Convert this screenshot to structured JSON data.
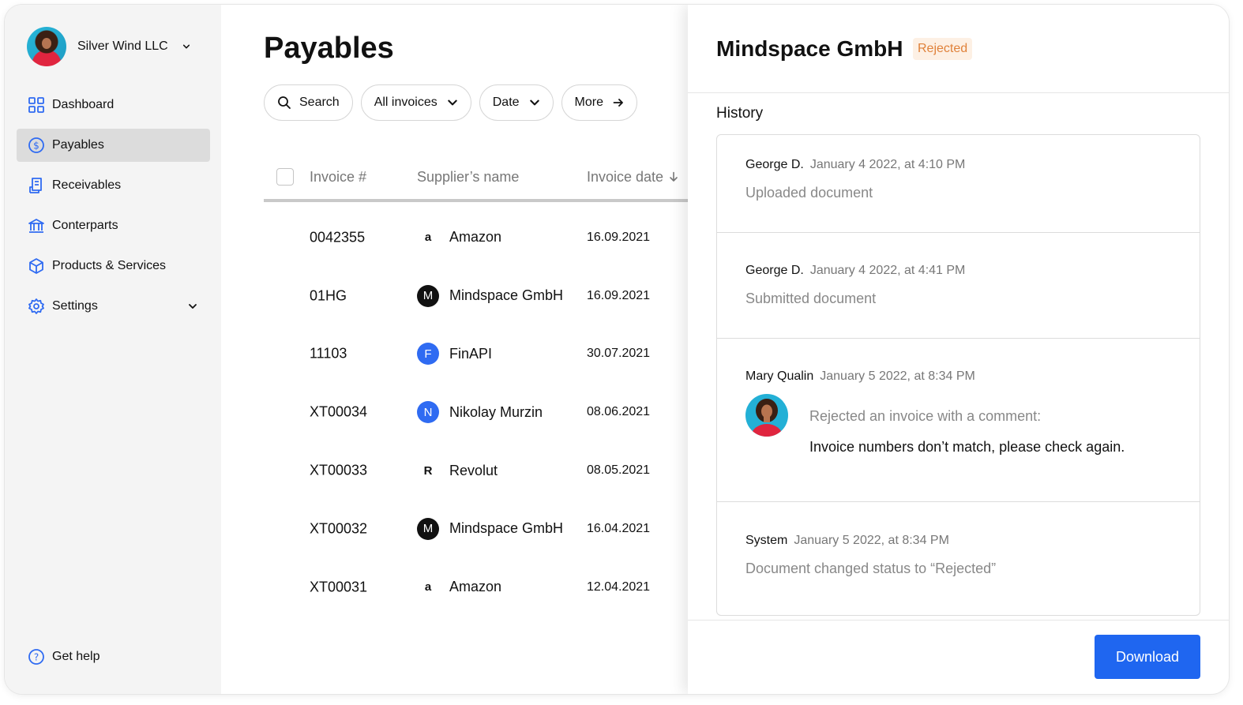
{
  "sidebar": {
    "org_name": "Silver Wind LLC",
    "items": [
      {
        "label": "Dashboard",
        "icon": "grid-icon"
      },
      {
        "label": "Payables",
        "icon": "dollar-circle-icon"
      },
      {
        "label": "Receivables",
        "icon": "receipt-icon"
      },
      {
        "label": "Conterparts",
        "icon": "bank-icon"
      },
      {
        "label": "Products & Services",
        "icon": "box-icon"
      },
      {
        "label": "Settings",
        "icon": "gear-icon"
      }
    ],
    "help_label": "Get help"
  },
  "main": {
    "title": "Payables",
    "filters": {
      "search": "Search",
      "all_invoices": "All invoices",
      "date": "Date",
      "more": "More"
    },
    "columns": {
      "invoice": "Invoice #",
      "supplier": "Supplier’s name",
      "date": "Invoice date"
    },
    "rows": [
      {
        "invoice": "0042355",
        "supplier": "Amazon",
        "logo": "a",
        "date": "16.09.2021"
      },
      {
        "invoice": "01HG",
        "supplier": "Mindspace GmbH",
        "logo": "M",
        "date": "16.09.2021"
      },
      {
        "invoice": "11103",
        "supplier": "FinAPI",
        "logo": "F",
        "date": "30.07.2021"
      },
      {
        "invoice": "XT00034",
        "supplier": "Nikolay Murzin",
        "logo": "N",
        "date": "08.06.2021"
      },
      {
        "invoice": "XT00033",
        "supplier": "Revolut",
        "logo": "R",
        "date": "08.05.2021"
      },
      {
        "invoice": "XT00032",
        "supplier": "Mindspace GmbH",
        "logo": "M",
        "date": "16.04.2021"
      },
      {
        "invoice": "XT00031",
        "supplier": "Amazon",
        "logo": "a",
        "date": "12.04.2021"
      }
    ]
  },
  "panel": {
    "title": "Mindspace GmbH",
    "status": "Rejected",
    "history_title": "History",
    "history": [
      {
        "who": "George D.",
        "when": "January 4 2022, at 4:10 PM",
        "action": "Uploaded document"
      },
      {
        "who": "George D.",
        "when": "January 4 2022, at 4:41 PM",
        "action": "Submitted document"
      },
      {
        "who": "Mary Qualin",
        "when": "January 5 2022, at 8:34 PM",
        "action": "Rejected an invoice with a comment:",
        "comment": "Invoice numbers don’t match, please check again."
      },
      {
        "who": "System",
        "when": "January 5 2022, at 8:34 PM",
        "action": "Document changed status to “Rejected”"
      }
    ],
    "download_label": "Download"
  },
  "colors": {
    "accent": "#1f66f0",
    "rejected_text": "#e0823b",
    "rejected_bg": "#fdf0e4",
    "nav_icon": "#2f6bf2"
  }
}
